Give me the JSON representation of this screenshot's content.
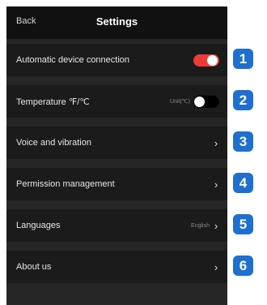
{
  "header": {
    "back_label": "Back",
    "title": "Settings"
  },
  "rows": [
    {
      "label": "Automatic device connection"
    },
    {
      "label": "Temperature ℉/℃",
      "value": "Unit(℃)"
    },
    {
      "label": "Voice and vibration"
    },
    {
      "label": "Permission management"
    },
    {
      "label": "Languages",
      "value": "English"
    },
    {
      "label": "About us"
    }
  ],
  "toggles": {
    "auto_connect_on": true,
    "temperature_on": false
  },
  "chevron": "›",
  "badges": [
    "1",
    "2",
    "3",
    "4",
    "5",
    "6"
  ],
  "colors": {
    "accent": "#ee3b35",
    "badge": "#1f6fd0",
    "panel": "#262626",
    "row": "#1b1b1b",
    "header": "#111111"
  }
}
